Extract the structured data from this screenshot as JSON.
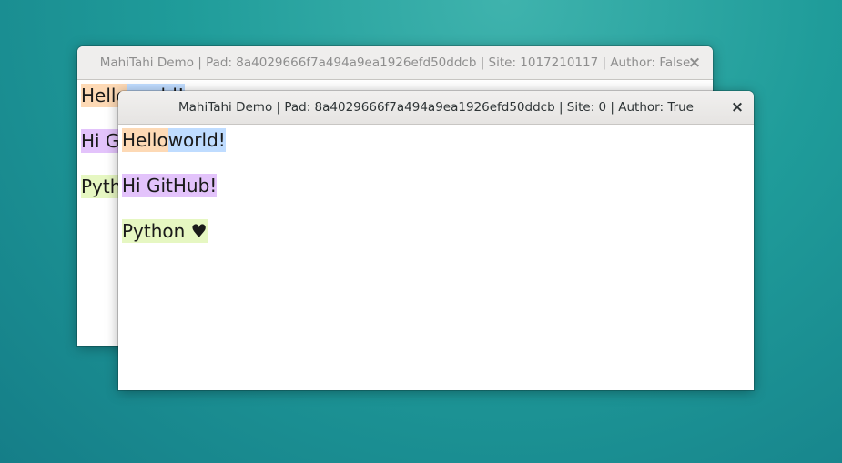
{
  "colors": {
    "desktop_start": "#3fb3ad",
    "desktop_end": "#157e88",
    "author_orange": "#fdd9b5",
    "author_blue": "#bfdcff",
    "author_purple": "#e3c3fb",
    "author_green": "#e6f7c2"
  },
  "windows": {
    "back": {
      "title": "MahiTahi Demo | Pad: 8a4029666f7a494a9ea1926efd50ddcb | Site: 1017210117 | Author: False",
      "close_glyph": "×",
      "lines": [
        {
          "segments": [
            {
              "text": "Hello",
              "color": "author_orange"
            },
            {
              "text": " world!",
              "color": "author_blue"
            }
          ]
        },
        {
          "segments": [
            {
              "text": "Hi GitHub!",
              "color": "author_purple"
            }
          ]
        },
        {
          "segments": [
            {
              "text": "Python ♥",
              "color": "author_green"
            }
          ]
        }
      ]
    },
    "front": {
      "title": "MahiTahi Demo | Pad: 8a4029666f7a494a9ea1926efd50ddcb | Site: 0 | Author: True",
      "close_glyph": "×",
      "lines": [
        {
          "segments": [
            {
              "text": "Hello",
              "color": "author_orange"
            },
            {
              "text": " world!",
              "color": "author_blue"
            }
          ]
        },
        {
          "segments": [
            {
              "text": "Hi GitHub!",
              "color": "author_purple"
            }
          ]
        },
        {
          "segments": [
            {
              "text": "Python ♥",
              "color": "author_green"
            }
          ]
        }
      ]
    }
  }
}
